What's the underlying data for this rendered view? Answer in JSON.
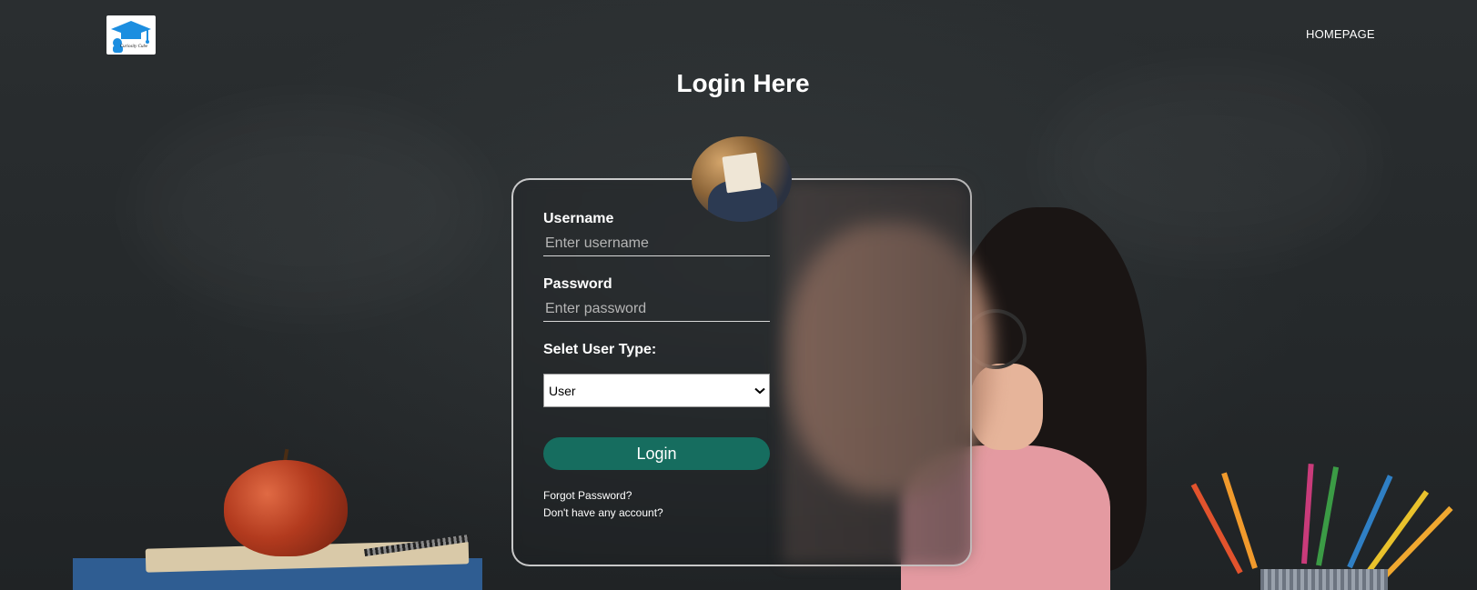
{
  "header": {
    "logo_alt": "Curiosity Cube",
    "nav": {
      "homepage": "HOMEPAGE"
    }
  },
  "page": {
    "title": "Login Here"
  },
  "form": {
    "username": {
      "label": "Username",
      "placeholder": "Enter username",
      "value": ""
    },
    "password": {
      "label": "Password",
      "placeholder": "Enter password",
      "value": ""
    },
    "user_type": {
      "label": "Selet User Type:",
      "selected": "User"
    },
    "login_button": "Login",
    "forgot_password": "Forgot Password?",
    "signup_prompt": "Don't have any account?"
  },
  "icons": {
    "logo": "graduation-cap-logo",
    "select_arrow": "chevron-down-icon"
  },
  "colors": {
    "login_button": "#166d5f",
    "text": "#ffffff",
    "background": "#23272a"
  }
}
